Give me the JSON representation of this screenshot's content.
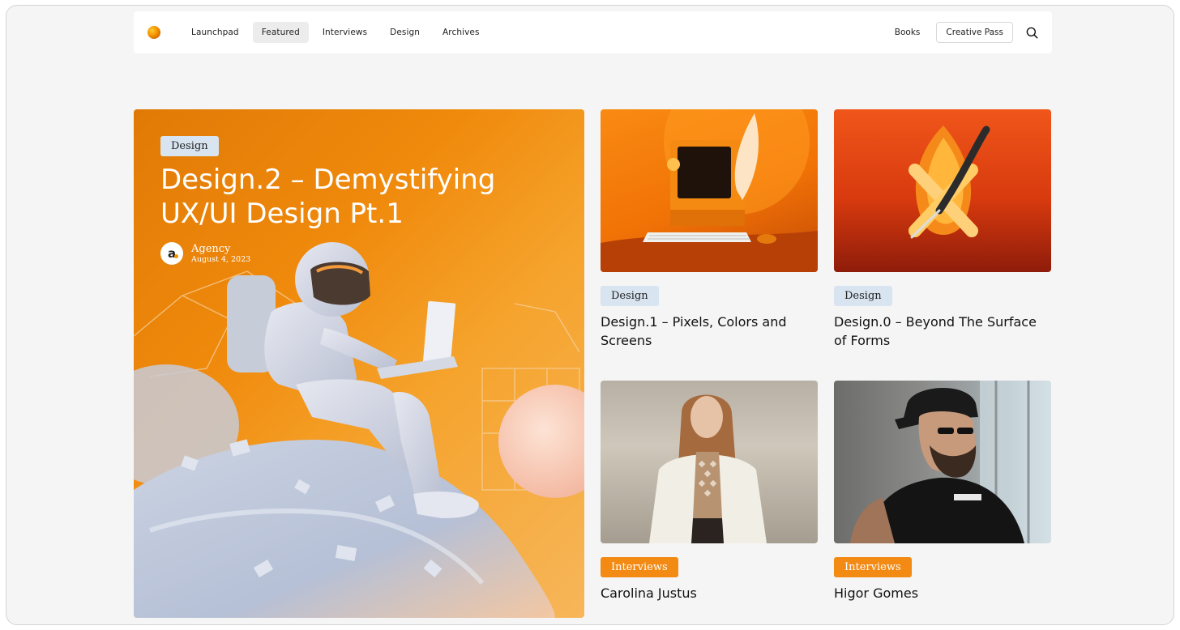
{
  "nav": {
    "links": [
      "Launchpad",
      "Featured",
      "Interviews",
      "Design",
      "Archives"
    ],
    "active": "Featured",
    "books": "Books",
    "creative_pass": "Creative Pass"
  },
  "hero": {
    "tag": "Design",
    "title": "Design.2 – Demystifying UX/UI Design Pt.1",
    "author": {
      "initial": "a",
      "name": "Agency",
      "date": "August 4, 2023"
    }
  },
  "cards": [
    {
      "tag": "Design",
      "title": "Design.1 – Pixels, Colors and Screens"
    },
    {
      "tag": "Design",
      "title": "Design.0 – Beyond The Surface of Forms"
    },
    {
      "tag": "Interviews",
      "title": "Carolina Justus"
    },
    {
      "tag": "Interviews",
      "title": "Higor Gomes"
    }
  ],
  "colors": {
    "accent": "#f28a14",
    "design_tag": "#d8e4f0",
    "background": "#f5f5f5"
  }
}
